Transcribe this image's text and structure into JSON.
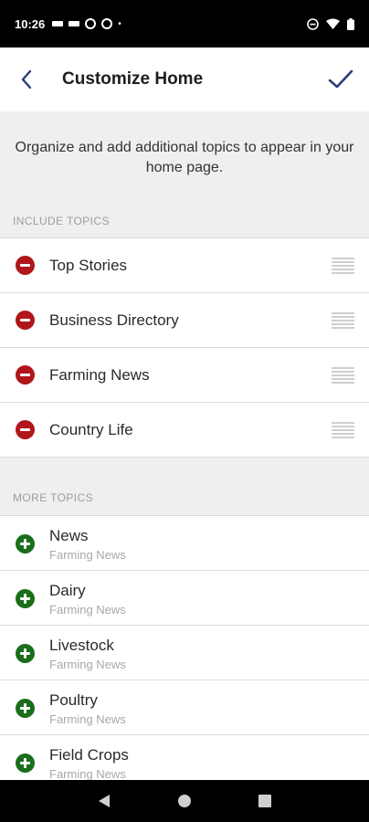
{
  "status_bar": {
    "time": "10:26",
    "left_icons": [
      "notification-icon",
      "notification-icon",
      "notification-icon",
      "notification-icon"
    ],
    "dot": "•",
    "right_icons": [
      "dnd-icon",
      "wifi-icon",
      "battery-icon"
    ]
  },
  "app_bar": {
    "title": "Customize Home",
    "back_icon": "chevron-left-icon",
    "done_icon": "check-icon",
    "accent_color": "#2c3e7a"
  },
  "description": "Organize and add additional topics to appear in your home page.",
  "include_section": {
    "header": "INCLUDE TOPICS",
    "items": [
      {
        "label": "Top Stories"
      },
      {
        "label": "Business Directory"
      },
      {
        "label": "Farming News"
      },
      {
        "label": "Country Life"
      }
    ],
    "remove_color": "#b0161b"
  },
  "more_section": {
    "header": "MORE TOPICS",
    "items": [
      {
        "name": "News",
        "category": "Farming News"
      },
      {
        "name": "Dairy",
        "category": "Farming News"
      },
      {
        "name": "Livestock",
        "category": "Farming News"
      },
      {
        "name": "Poultry",
        "category": "Farming News"
      },
      {
        "name": "Field Crops",
        "category": "Farming News"
      }
    ],
    "add_color": "#1a6e1a"
  },
  "nav_bar": {
    "icons": [
      "back-triangle-icon",
      "home-circle-icon",
      "recents-square-icon"
    ]
  }
}
